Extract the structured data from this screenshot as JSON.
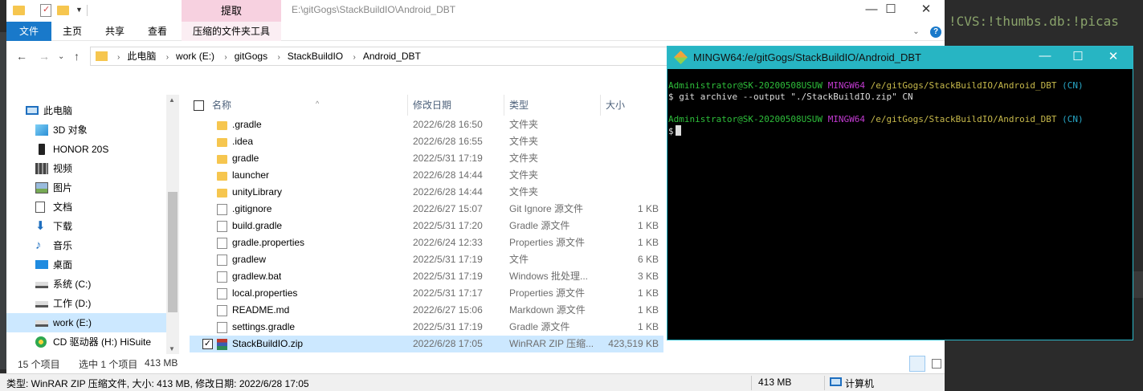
{
  "ide": {
    "background_text": "!CVS:!thumbs.db:!picas"
  },
  "explorer": {
    "ribbon_context_group": "提取",
    "window_path_title": "E:\\gitGogs\\StackBuildIO\\Android_DBT",
    "ribbon_tabs": [
      "文件",
      "主页",
      "共享",
      "查看",
      "压缩的文件夹工具"
    ],
    "breadcrumb": [
      "此电脑",
      "work (E:)",
      "gitGogs",
      "StackBuildIO",
      "Android_DBT"
    ],
    "nav_items": [
      {
        "label": "此电脑",
        "icon": "computer-icon"
      },
      {
        "label": "3D 对象",
        "icon": "cube-icon"
      },
      {
        "label": "HONOR 20S",
        "icon": "phone-icon"
      },
      {
        "label": "视频",
        "icon": "video-icon"
      },
      {
        "label": "图片",
        "icon": "picture-icon"
      },
      {
        "label": "文档",
        "icon": "document-icon"
      },
      {
        "label": "下载",
        "icon": "download-icon"
      },
      {
        "label": "音乐",
        "icon": "music-icon"
      },
      {
        "label": "桌面",
        "icon": "desktop-icon"
      },
      {
        "label": "系统 (C:)",
        "icon": "drive-icon"
      },
      {
        "label": "工作 (D:)",
        "icon": "drive-icon"
      },
      {
        "label": "work (E:)",
        "icon": "drive-icon",
        "selected": true
      },
      {
        "label": "CD 驱动器 (H:) HiSuite",
        "icon": "cd-drive-icon"
      }
    ],
    "columns": {
      "name": "名称",
      "date": "修改日期",
      "type": "类型",
      "size": "大小"
    },
    "files": [
      {
        "name": ".gradle",
        "date": "2022/6/28 16:50",
        "type": "文件夹",
        "size": "",
        "icon": "folder-icon"
      },
      {
        "name": ".idea",
        "date": "2022/6/28 16:55",
        "type": "文件夹",
        "size": "",
        "icon": "folder-icon"
      },
      {
        "name": "gradle",
        "date": "2022/5/31 17:19",
        "type": "文件夹",
        "size": "",
        "icon": "folder-icon"
      },
      {
        "name": "launcher",
        "date": "2022/6/28 14:44",
        "type": "文件夹",
        "size": "",
        "icon": "folder-icon"
      },
      {
        "name": "unityLibrary",
        "date": "2022/6/28 14:44",
        "type": "文件夹",
        "size": "",
        "icon": "folder-icon"
      },
      {
        "name": ".gitignore",
        "date": "2022/6/27 15:07",
        "type": "Git Ignore 源文件",
        "size": "1 KB",
        "icon": "file-icon"
      },
      {
        "name": "build.gradle",
        "date": "2022/5/31 17:20",
        "type": "Gradle 源文件",
        "size": "1 KB",
        "icon": "file-icon"
      },
      {
        "name": "gradle.properties",
        "date": "2022/6/24 12:33",
        "type": "Properties 源文件",
        "size": "1 KB",
        "icon": "file-icon"
      },
      {
        "name": "gradlew",
        "date": "2022/5/31 17:19",
        "type": "文件",
        "size": "6 KB",
        "icon": "file-icon"
      },
      {
        "name": "gradlew.bat",
        "date": "2022/5/31 17:19",
        "type": "Windows 批处理...",
        "size": "3 KB",
        "icon": "batch-file-icon"
      },
      {
        "name": "local.properties",
        "date": "2022/5/31 17:17",
        "type": "Properties 源文件",
        "size": "1 KB",
        "icon": "file-icon"
      },
      {
        "name": "README.md",
        "date": "2022/6/27 15:06",
        "type": "Markdown 源文件",
        "size": "1 KB",
        "icon": "file-icon"
      },
      {
        "name": "settings.gradle",
        "date": "2022/5/31 17:19",
        "type": "Gradle 源文件",
        "size": "1 KB",
        "icon": "file-icon"
      },
      {
        "name": "StackBuildIO.zip",
        "date": "2022/6/28 17:05",
        "type": "WinRAR ZIP 压缩...",
        "size": "423,519 KB",
        "icon": "zip-archive-icon",
        "selected": true
      }
    ],
    "status": {
      "item_count": "15 个项目",
      "selected": "选中 1 个项目",
      "selected_size": "413 MB"
    }
  },
  "infobar": {
    "details": "类型: WinRAR ZIP 压缩文件, 大小: 413 MB, 修改日期: 2022/6/28 17:05",
    "size": "413 MB",
    "location": "计算机"
  },
  "terminal": {
    "title": "MINGW64:/e/gitGogs/StackBuildIO/Android_DBT",
    "prompt_user": "Administrator@SK-20200508USUW",
    "prompt_env": "MINGW64",
    "prompt_path": "/e/gitGogs/StackBuildIO/Android_DBT",
    "prompt_branch": "(CN)",
    "command": "$ git archive --output \"./StackBuildIO.zip\" CN",
    "prompt_symbol": "$"
  }
}
